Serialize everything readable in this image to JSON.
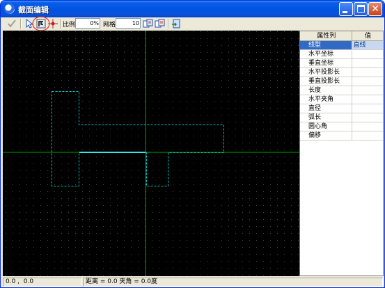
{
  "window": {
    "title": "截面编辑",
    "min_icon": "minimize-icon",
    "max_icon": "maximize-icon",
    "close_icon": "close-icon",
    "close_glyph": "✕"
  },
  "toolbar": {
    "icons": [
      "confirm-check-icon",
      "select-arrow-icon",
      "node-edit-icon",
      "crosshair-icon",
      "copy-section-icon",
      "paste-section-icon",
      "export-icon"
    ],
    "scale_label": "比例",
    "scale_value": "0%",
    "grid_label": "网格",
    "grid_value": "10"
  },
  "properties": {
    "headers": [
      "属性列",
      "值"
    ],
    "rows": [
      {
        "name": "线型",
        "value": "直线",
        "selected": true
      },
      {
        "name": "水平坐标",
        "value": ""
      },
      {
        "name": "垂直坐标",
        "value": ""
      },
      {
        "name": "水平投影长",
        "value": ""
      },
      {
        "name": "垂直投影长",
        "value": ""
      },
      {
        "name": "长度",
        "value": ""
      },
      {
        "name": "水平夹角",
        "value": ""
      },
      {
        "name": "直径",
        "value": ""
      },
      {
        "name": "弧长",
        "value": ""
      },
      {
        "name": "圆心角",
        "value": ""
      },
      {
        "name": "偏移",
        "value": ""
      }
    ]
  },
  "status": {
    "coords": "0.0 ,  0.0",
    "measure": "距离 = 0.0 夹角 = 0.0度"
  },
  "colors": {
    "canvas_bg": "#000000",
    "axis": "#00a000",
    "grid_dot": "#4a4a4a",
    "outline": "#00c8c8",
    "selected_segment": "#40e0e0",
    "highlight_circle": "#e03030"
  }
}
